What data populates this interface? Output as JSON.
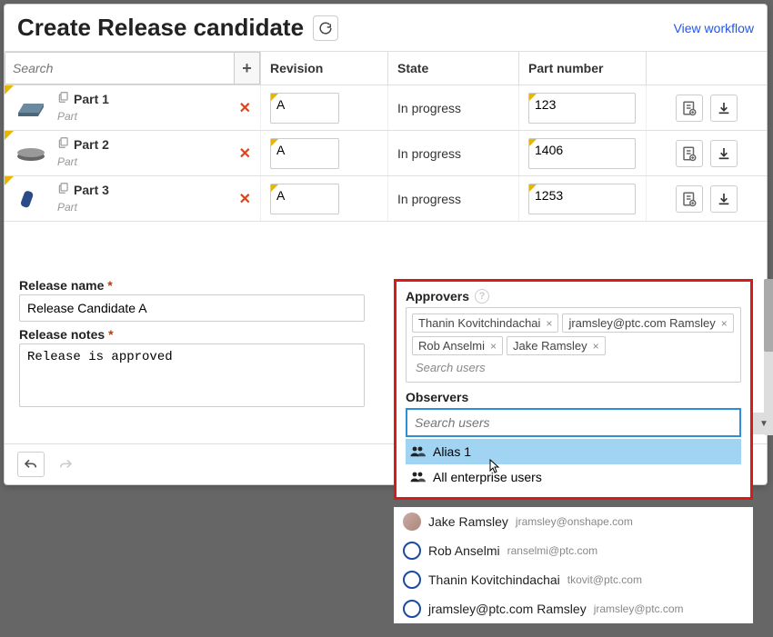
{
  "header": {
    "title": "Create Release candidate",
    "workflow_link": "View workflow"
  },
  "columns": {
    "revision": "Revision",
    "state": "State",
    "part": "Part number"
  },
  "search_placeholder": "Search",
  "rows": [
    {
      "name": "Part 1",
      "type": "Part",
      "rev": "A",
      "state": "In progress",
      "part": "123"
    },
    {
      "name": "Part 2",
      "type": "Part",
      "rev": "A",
      "state": "In progress",
      "part": "1406"
    },
    {
      "name": "Part 3",
      "type": "Part",
      "rev": "A",
      "state": "In progress",
      "part": "1253"
    }
  ],
  "form": {
    "release_name_label": "Release name",
    "release_name_value": "Release Candidate A",
    "release_notes_label": "Release notes",
    "release_notes_value": "Release is approved"
  },
  "approvers": {
    "label": "Approvers",
    "chips": [
      "Thanin Kovitchindachai",
      "jramsley@ptc.com Ramsley",
      "Rob Anselmi",
      "Jake Ramsley"
    ],
    "placeholder": "Search users"
  },
  "observers": {
    "label": "Observers",
    "placeholder": "Search users",
    "options": [
      "Alias 1",
      "All enterprise users"
    ]
  },
  "suggestions": [
    {
      "name": "Jake Ramsley",
      "email": "jramsley@onshape.com",
      "photo": true
    },
    {
      "name": "Rob Anselmi",
      "email": "ranselmi@ptc.com",
      "photo": false
    },
    {
      "name": "Thanin Kovitchindachai",
      "email": "tkovit@ptc.com",
      "photo": false
    },
    {
      "name": "jramsley@ptc.com Ramsley",
      "email": "jramsley@ptc.com",
      "photo": false
    }
  ]
}
